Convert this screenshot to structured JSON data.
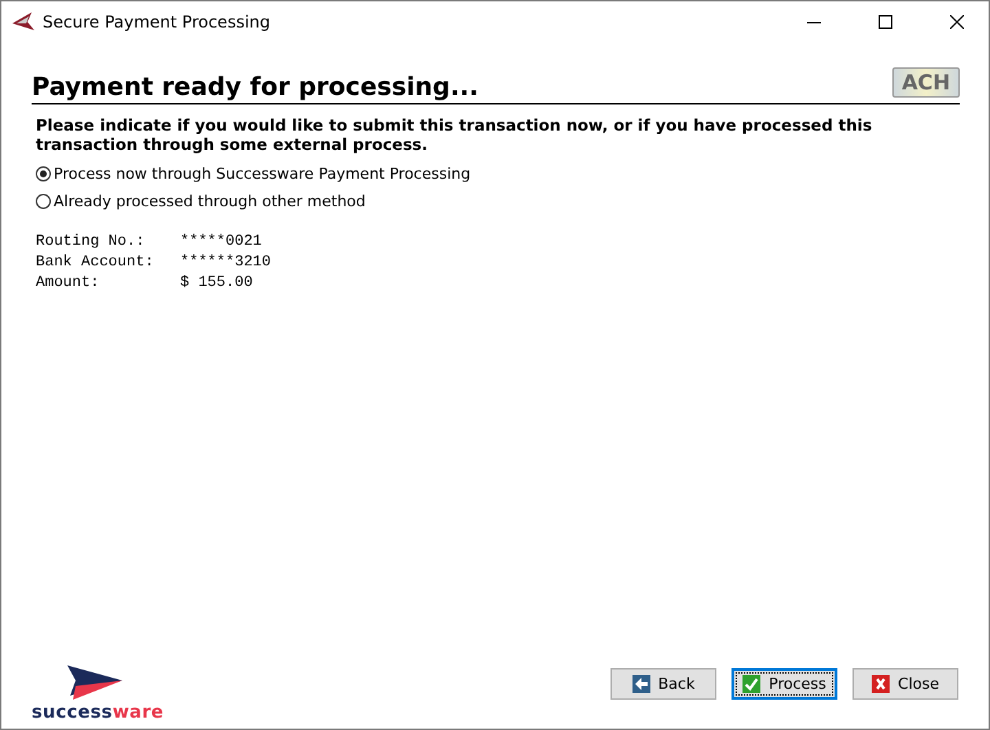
{
  "window": {
    "title": "Secure Payment Processing"
  },
  "heading": "Payment ready for processing...",
  "badge": "ACH",
  "instruction": "Please indicate if you would like to submit this transaction now, or if you have processed this transaction through some external process.",
  "options": [
    {
      "label": "Process now through Successware Payment Processing",
      "selected": true
    },
    {
      "label": "Already processed through other method",
      "selected": false
    }
  ],
  "details": [
    {
      "label": "Routing No.:",
      "value": "*****0021"
    },
    {
      "label": "Bank Account:",
      "value": "******3210"
    },
    {
      "label": "Amount:",
      "value": "$ 155.00"
    }
  ],
  "logo": {
    "first": "success",
    "second": "ware"
  },
  "buttons": [
    {
      "label": "Back",
      "kind": "back",
      "focused": false
    },
    {
      "label": "Process",
      "kind": "process",
      "focused": true
    },
    {
      "label": "Close",
      "kind": "close",
      "focused": false
    }
  ]
}
